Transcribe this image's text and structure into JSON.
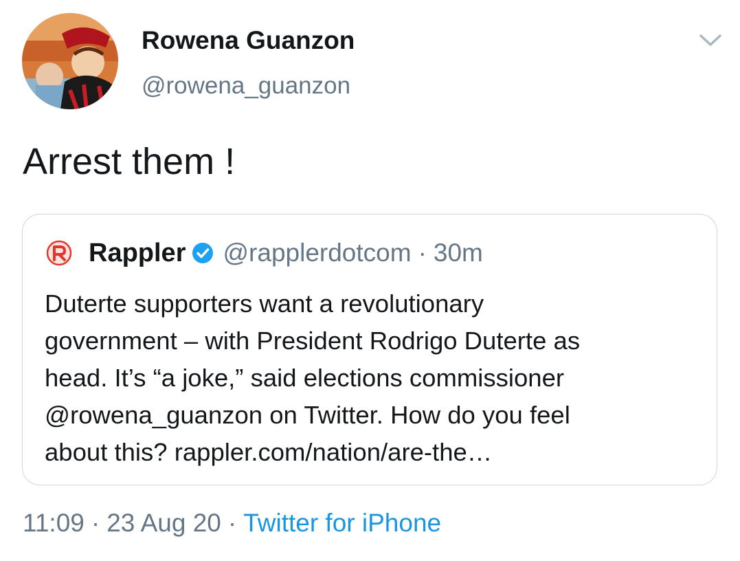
{
  "author": {
    "name": "Rowena Guanzon",
    "handle": "@rowena_guanzon"
  },
  "tweet": {
    "text": "Arrest them !"
  },
  "quoted_tweet": {
    "name": "Rappler",
    "handle": "@rapplerdotcom",
    "separator": "·",
    "time": "30m",
    "text_lines": [
      "Duterte supporters want a revolutionary",
      "government – with President Rodrigo Duterte as",
      "head. It’s “a joke,” said elections commissioner",
      "@rowena_guanzon on Twitter. How do you feel",
      "about this? rappler.com/nation/are-the…"
    ]
  },
  "footer": {
    "time": "11:09",
    "separator": "·",
    "date": "23 Aug 20",
    "source": "Twitter for iPhone"
  },
  "icons": {
    "menu": "chevron-down-icon",
    "logo": "rappler-logo-icon",
    "verified": "verified-badge-icon"
  },
  "colors": {
    "text": "#14171a",
    "secondary": "#657786",
    "link": "#1b95e0",
    "verified": "#1da1f2",
    "border": "#ccd6dd",
    "rappler_brand": "#e2362b"
  }
}
